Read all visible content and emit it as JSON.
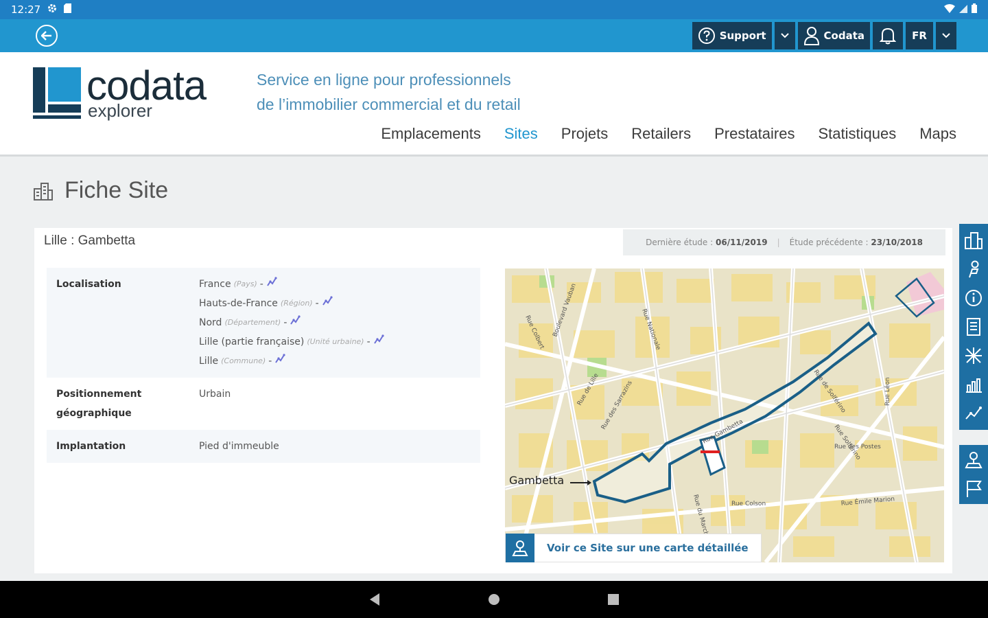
{
  "status_bar": {
    "time": "12:27"
  },
  "toolbar": {
    "support_label": "Support",
    "user_label": "Codata",
    "language": "FR"
  },
  "logo": {
    "name": "codata",
    "sub": "explorer"
  },
  "tagline": {
    "line1": "Service en ligne pour professionnels",
    "line2": "de l’immobilier commercial et du retail"
  },
  "nav": {
    "items": [
      {
        "label": "Emplacements"
      },
      {
        "label": "Sites"
      },
      {
        "label": "Projets"
      },
      {
        "label": "Retailers"
      },
      {
        "label": "Prestataires"
      },
      {
        "label": "Statistiques"
      },
      {
        "label": "Maps"
      }
    ],
    "active_index": 1
  },
  "page": {
    "title": "Fiche Site"
  },
  "site": {
    "name": "Lille : Gambetta",
    "last_study_label": "Dernière étude :",
    "last_study_date": "06/11/2019",
    "prev_study_label": "Étude précédente :",
    "prev_study_date": "23/10/2018",
    "localisation_label": "Localisation",
    "localisation": [
      {
        "name": "France",
        "type": "(Pays)"
      },
      {
        "name": "Hauts-de-France",
        "type": "(Région)"
      },
      {
        "name": "Nord",
        "type": "(Département)"
      },
      {
        "name": "Lille (partie française)",
        "type": "(Unité urbaine)"
      },
      {
        "name": "Lille",
        "type": "(Commune)"
      }
    ],
    "positionnement_label_1": "Positionnement",
    "positionnement_label_2": "géographique",
    "positionnement_value": "Urbain",
    "implantation_label": "Implantation",
    "implantation_value": "Pied d'immeuble"
  },
  "map": {
    "marker_label": "Gambetta",
    "link_label": "Voir ce Site sur une carte détaillée",
    "street_labels": [
      "Rue Gambetta",
      "Rue Solférino",
      "Rue de Solférino",
      "Rue des Postes",
      "Rue Léon",
      "Rue Émile Marion",
      "Rue Colbert",
      "Boulevard Vauban",
      "Rue Nationale",
      "Rue de Lille",
      "Rue des Sarrazins",
      "Rue Colson",
      "Rue du Marché"
    ]
  },
  "colors": {
    "status_bar": "#1f7fc4",
    "top_bar": "#2196cf",
    "toolbar_button": "#163d58",
    "accent": "#2196cf",
    "sidebar": "#1e6fa3",
    "tagline": "#4d8fb8",
    "perimeter": "#1a5f87"
  }
}
